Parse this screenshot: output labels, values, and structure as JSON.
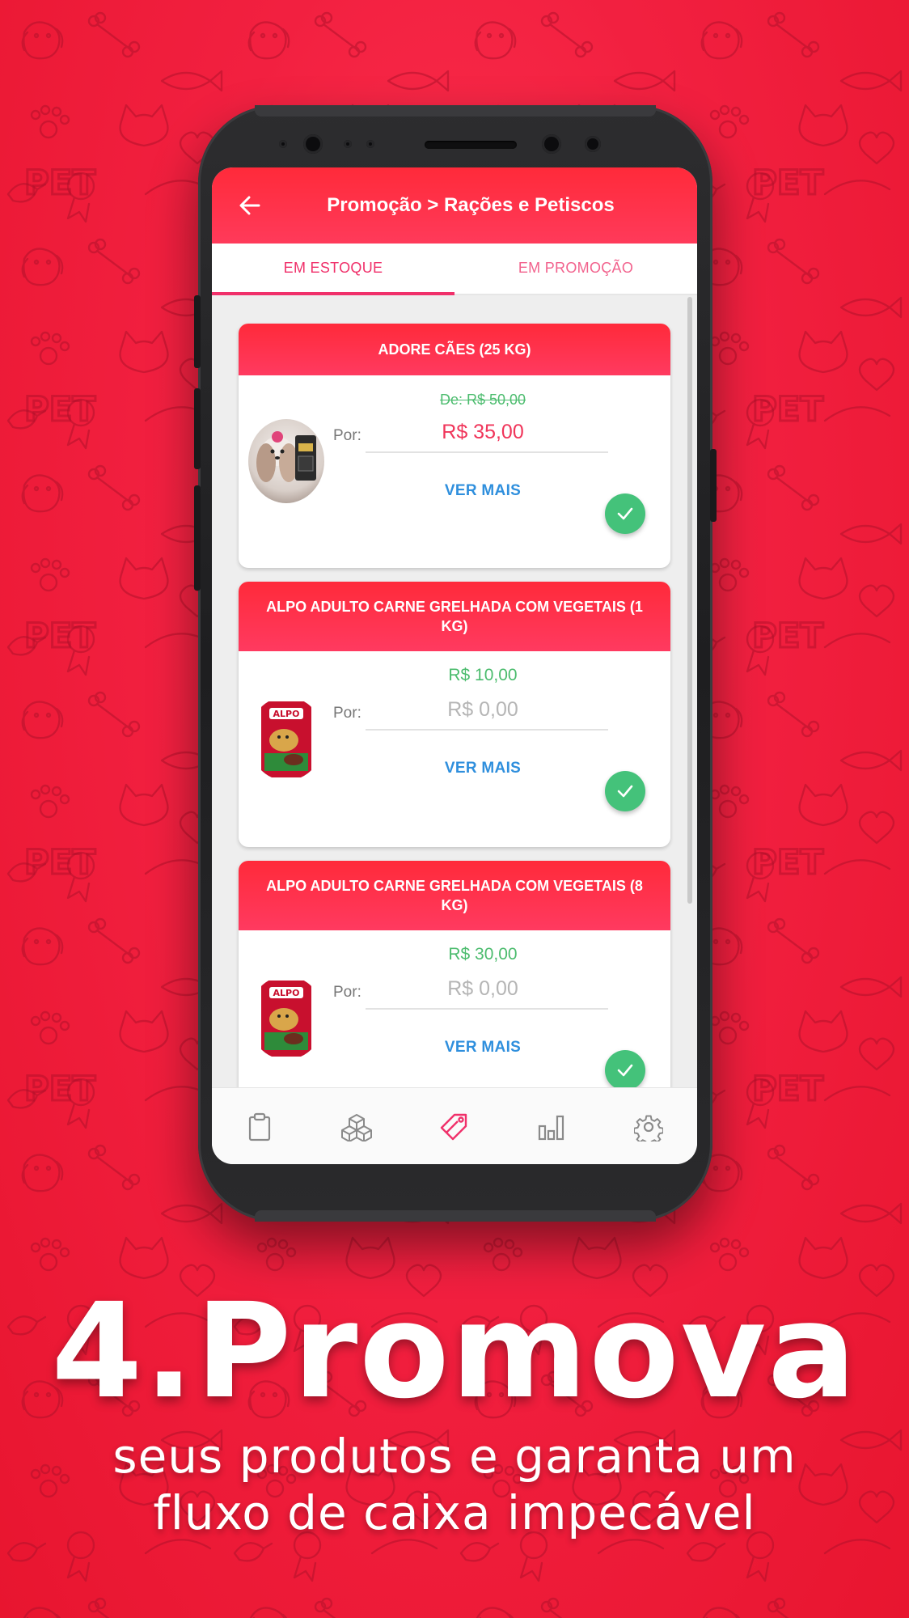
{
  "app": {
    "title": "Promoção > Rações e Petiscos"
  },
  "tabs": [
    {
      "label": "EM ESTOQUE",
      "active": true
    },
    {
      "label": "EM PROMOÇÃO",
      "active": false
    }
  ],
  "products": [
    {
      "name": "ADORE CÃES (25 KG)",
      "original_price": "De: R$ 50,00",
      "por_label": "Por:",
      "price": "R$ 35,00",
      "more_label": "VER MAIS"
    },
    {
      "name": "ALPO ADULTO CARNE GRELHADA COM VEGETAIS (1 KG)",
      "original_price": "R$ 10,00",
      "por_label": "Por:",
      "price": "R$ 0,00",
      "more_label": "VER MAIS"
    },
    {
      "name": "ALPO ADULTO CARNE GRELHADA COM VEGETAIS (8 KG)",
      "original_price": "R$ 30,00",
      "por_label": "Por:",
      "price": "R$ 0,00",
      "more_label": "VER MAIS"
    }
  ],
  "bottom_nav": [
    {
      "icon": "clipboard-icon",
      "active": false
    },
    {
      "icon": "boxes-icon",
      "active": false
    },
    {
      "icon": "tag-icon",
      "active": true
    },
    {
      "icon": "bar-chart-icon",
      "active": false
    },
    {
      "icon": "gear-icon",
      "active": false
    }
  ],
  "promo": {
    "headline": "4.Promova",
    "subline_1": "seus produtos e garanta um",
    "subline_2": "fluxo de caixa impecável"
  },
  "colors": {
    "background": "#f22040",
    "accent": "#f0306a",
    "price_red": "#f0355a",
    "price_green": "#4cbc6e",
    "link_blue": "#2f8fdd",
    "check_green": "#44c27a"
  }
}
